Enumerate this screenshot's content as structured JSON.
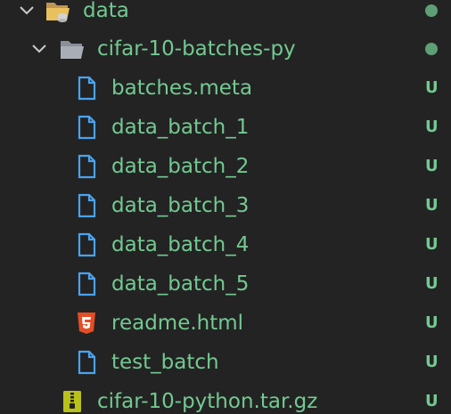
{
  "colors": {
    "background": "#232323",
    "untracked": "#73c991",
    "folder_dot": "#73c991",
    "file_icon": "#4aa3f0",
    "html_icon": "#e44d26",
    "archive_icon": "#b8c21a"
  },
  "tree": {
    "root_folder": {
      "label": "data",
      "icon": "folder-open-icon",
      "expanded": true
    },
    "subfolder": {
      "label": "cifar-10-batches-py",
      "icon": "folder-open-icon",
      "expanded": true
    },
    "files": [
      {
        "label": "batches.meta",
        "status": "U",
        "icon": "file-icon"
      },
      {
        "label": "data_batch_1",
        "status": "U",
        "icon": "file-icon"
      },
      {
        "label": "data_batch_2",
        "status": "U",
        "icon": "file-icon"
      },
      {
        "label": "data_batch_3",
        "status": "U",
        "icon": "file-icon"
      },
      {
        "label": "data_batch_4",
        "status": "U",
        "icon": "file-icon"
      },
      {
        "label": "data_batch_5",
        "status": "U",
        "icon": "file-icon"
      },
      {
        "label": "readme.html",
        "status": "U",
        "icon": "html5-icon"
      },
      {
        "label": "test_batch",
        "status": "U",
        "icon": "file-icon"
      }
    ],
    "archive": {
      "label": "cifar-10-python.tar.gz",
      "status": "U",
      "icon": "zip-archive-icon"
    }
  }
}
